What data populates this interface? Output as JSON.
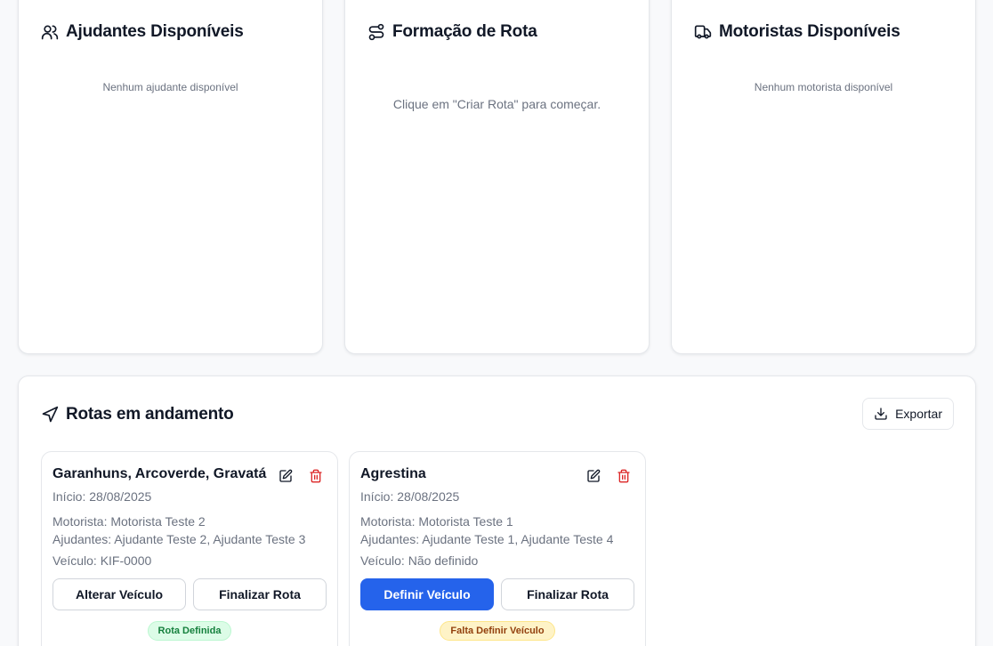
{
  "helpers_panel": {
    "title": "Ajudantes Disponíveis",
    "empty_text": "Nenhum ajudante disponível"
  },
  "route_panel": {
    "title": "Formação de Rota",
    "empty_text": "Clique em \"Criar Rota\" para começar."
  },
  "drivers_panel": {
    "title": "Motoristas Disponíveis",
    "empty_text": "Nenhum motorista disponível"
  },
  "active_routes": {
    "title": "Rotas em andamento",
    "export_label": "Exportar",
    "routes": [
      {
        "name": "Garanhuns, Arcoverde, Gravatá",
        "start": "Início: 28/08/2025",
        "driver": "Motorista: Motorista Teste 2",
        "helpers": "Ajudantes: Ajudante Teste 2, Ajudante Teste 3",
        "vehicle": "Veículo: KIF-0000",
        "primary_action": "Alterar Veículo",
        "secondary_action": "Finalizar Rota",
        "status": "Rota Definida"
      },
      {
        "name": "Agrestina",
        "start": "Início: 28/08/2025",
        "driver": "Motorista: Motorista Teste 1",
        "helpers": "Ajudantes: Ajudante Teste 1, Ajudante Teste 4",
        "vehicle": "Veículo: Não definido",
        "primary_action": "Definir Veículo",
        "secondary_action": "Finalizar Rota",
        "status": "Falta Definir Veículo"
      }
    ]
  },
  "colors": {
    "primary": "#2563eb",
    "danger": "#dc2626",
    "success_bg": "#dcfce7",
    "warning_bg": "#fef3c7"
  }
}
